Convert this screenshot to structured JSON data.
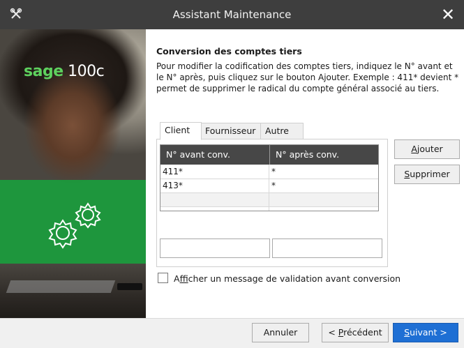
{
  "window": {
    "title": "Assistant Maintenance",
    "close_glyph": "✕",
    "app_icon": "tools-icon"
  },
  "brand": {
    "name": "sage",
    "product": "100c"
  },
  "content": {
    "heading": "Conversion des comptes tiers",
    "description": "Pour modifier la codification des comptes tiers, indiquez le N° avant et le N° après, puis cliquez sur le bouton Ajouter. Exemple : 411* devient * permet de supprimer le radical du compte général associé au tiers."
  },
  "tabs": [
    "Client",
    "Fournisseur",
    "Autre"
  ],
  "grid": {
    "columns": [
      "N° avant conv.",
      "N° après conv."
    ],
    "rows": [
      [
        "411*",
        "*"
      ],
      [
        "413*",
        "*"
      ]
    ]
  },
  "inputs": {
    "before_value": "",
    "after_value": ""
  },
  "buttons": {
    "add": {
      "pre": "",
      "mn": "A",
      "post": "jouter"
    },
    "delete": {
      "pre": "",
      "mn": "S",
      "post": "upprimer"
    },
    "cancel": "Annuler",
    "previous": {
      "pre": "< ",
      "mn": "P",
      "post": "récédent"
    },
    "next": {
      "pre": "",
      "mn": "S",
      "post": "uivant >"
    }
  },
  "checkbox": {
    "pre": "A",
    "mn": "f",
    "post": "ficher un message de validation avant conversion",
    "checked": false
  },
  "colors": {
    "titlebar": "#3e3e3e",
    "accent": "#1e6fd4",
    "brand_green": "#17a33c"
  }
}
